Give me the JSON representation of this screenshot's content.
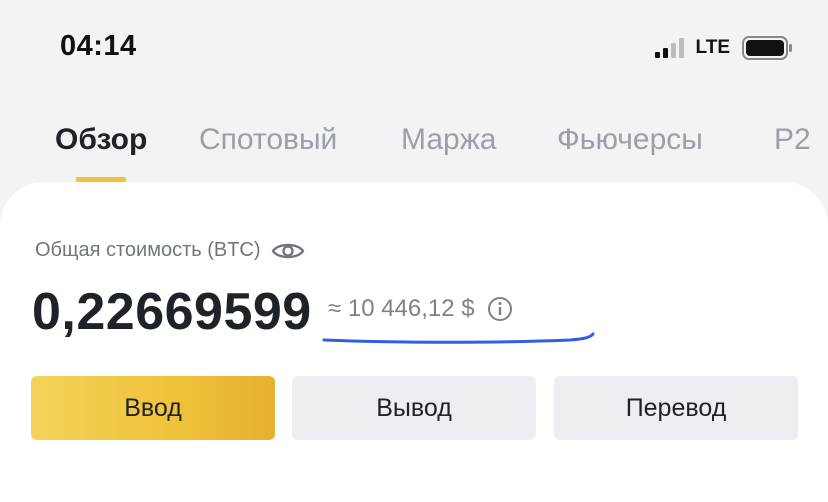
{
  "status_bar": {
    "time": "04:14",
    "network": "LTE"
  },
  "tabs": [
    {
      "label": "Обзор",
      "active": true
    },
    {
      "label": "Спотовый",
      "active": false
    },
    {
      "label": "Маржа",
      "active": false
    },
    {
      "label": "Фьючерсы",
      "active": false
    },
    {
      "label": "P2",
      "active": false
    }
  ],
  "balance": {
    "label": "Общая стоимость (BTC)",
    "btc_value": "0,22669599",
    "usd_approx": "≈ 10 446,12 $"
  },
  "buttons": {
    "deposit": "Ввод",
    "withdraw": "Вывод",
    "transfer": "Перевод"
  },
  "colors": {
    "accent": "#f0c33c",
    "annotation_line": "#2f5de8",
    "text_primary": "#1e2329",
    "text_secondary": "#9aa0a8"
  },
  "icons": {
    "signal": "signal-icon",
    "battery": "battery-icon",
    "visibility": "eye-icon",
    "info": "info-icon"
  }
}
